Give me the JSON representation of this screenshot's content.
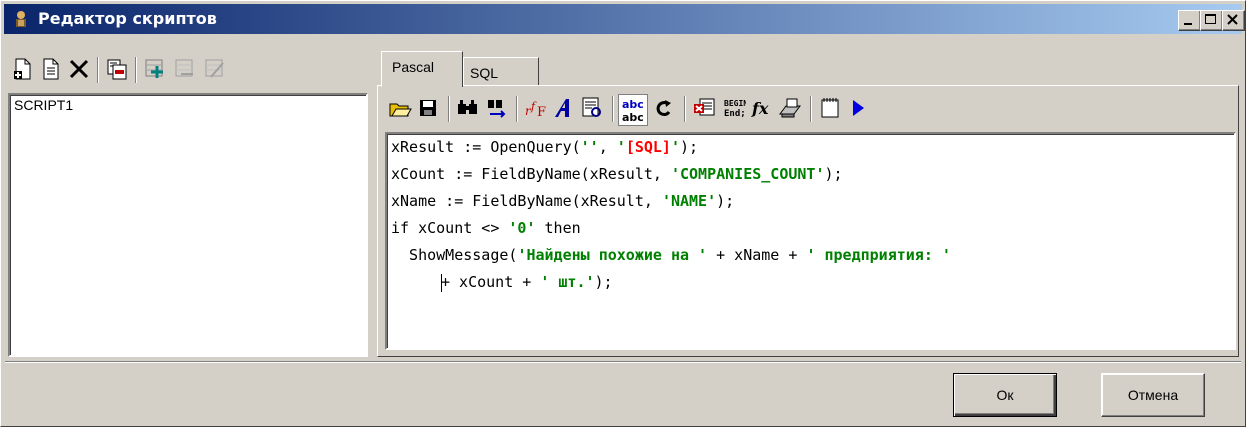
{
  "window": {
    "title": "Редактор скриптов"
  },
  "left_toolbar": {
    "icons": [
      "new-script-icon",
      "script-properties-icon",
      "delete-icon",
      "copy-script-icon",
      "add-icon",
      "remove-icon",
      "edit-icon"
    ]
  },
  "script_list": {
    "items": [
      "SCRIPT1"
    ]
  },
  "tabs": [
    {
      "label": "Pascal",
      "active": true
    },
    {
      "label": "SQL",
      "active": false
    }
  ],
  "editor_toolbar": {
    "icons": [
      "open-file-icon",
      "save-icon",
      "find-icon",
      "find-next-icon",
      "font-size-icon",
      "font-icon",
      "print-preview-icon",
      "spellcheck-icon",
      "redo-icon",
      "debug-icon",
      "begin-end-icon",
      "function-icon",
      "printer-icon",
      "blank-page-icon",
      "run-icon"
    ]
  },
  "code": {
    "line1": {
      "a": "xResult := OpenQuery(",
      "b": "''",
      "c": ", ",
      "d": "'",
      "e": "[SQL]",
      "f": "'",
      "g": ");"
    },
    "line2": {
      "a": "xCount := FieldByName(xResult, ",
      "b": "'COMPANIES_COUNT'",
      "c": ");"
    },
    "line3": {
      "a": "xName := FieldByName(xResult, ",
      "b": "'NAME'",
      "c": ");"
    },
    "line4": {
      "a": "if xCount <> ",
      "b": "'0'",
      "c": " then"
    },
    "line5": {
      "a": "  ShowMessage(",
      "b": "'Найдены похожие на '",
      "c": " + xName + ",
      "d": "' предприятия: '"
    },
    "line6": {
      "a": "+ xCount + ",
      "b": "' шт.'",
      "c": ");"
    }
  },
  "buttons": {
    "ok": "Ок",
    "cancel": "Отмена"
  }
}
